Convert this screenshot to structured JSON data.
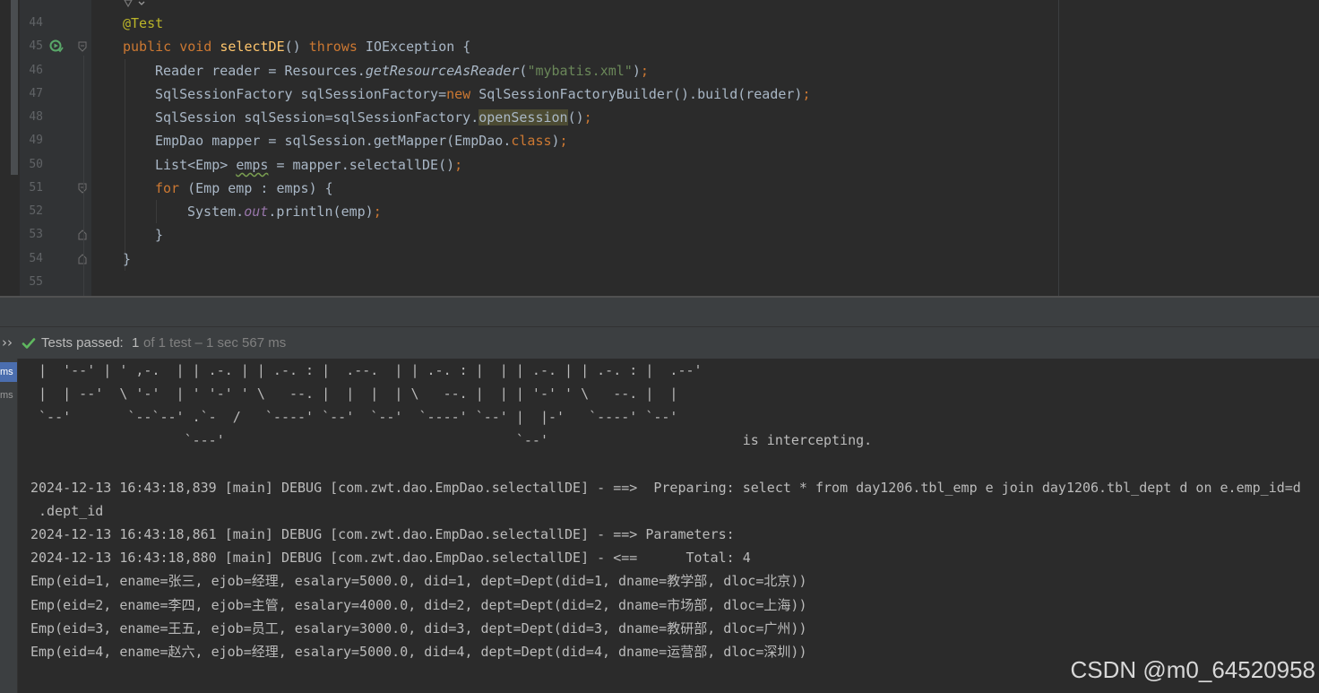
{
  "editor": {
    "line_numbers": [
      "44",
      "45",
      "46",
      "47",
      "48",
      "49",
      "50",
      "51",
      "52",
      "53",
      "54",
      "55"
    ],
    "code": {
      "l44": {
        "annotation": "@Test"
      },
      "l45": {
        "kw1": "public",
        "kw2": "void",
        "method": "selectDE",
        "paren": "() ",
        "kw3": "throws",
        "rest": " IOException {"
      },
      "l46": {
        "a": "Reader reader = Resources.",
        "b": "getResourceAsReader",
        "c": "(",
        "d": "\"mybatis.xml\"",
        "e": ")",
        "f": ";"
      },
      "l47": {
        "a": "SqlSessionFactory sqlSessionFactory=",
        "b": "new",
        "c": " SqlSessionFactoryBuilder().build(reader)",
        "d": ";"
      },
      "l48": {
        "a": "SqlSession sqlSession=sqlSessionFactory.",
        "b": "openSession",
        "c": "()",
        "d": ";"
      },
      "l49": {
        "a": "EmpDao mapper = sqlSession.getMapper(EmpDao.",
        "b": "class",
        "c": ")",
        "d": ";"
      },
      "l50": {
        "a": "List<Emp> ",
        "b": "emps",
        "c": " = mapper.selectallDE()",
        "d": ";"
      },
      "l51": {
        "a": "for",
        "b": " (Emp emp : emps) {"
      },
      "l52": {
        "a": "System.",
        "b": "out",
        "c": ".println(emp)",
        "d": ";"
      },
      "l53": {
        "a": "}"
      },
      "l54": {
        "a": "}"
      }
    }
  },
  "test_bar": {
    "chevron": "››",
    "label": "Tests passed:",
    "count": "1",
    "detail": "of 1 test – 1 sec 567 ms"
  },
  "side_tree": [
    "ms",
    "ms"
  ],
  "console": {
    "lines": [
      " |  '--' | ' ,-.  | | .-. | | .-. : |  .--.  | | .-. : |  | | .-. | | .-. : |  .--'",
      " |  | --'  \\ '-'  | ' '-' ' \\   --. |  |  |  | \\   --. |  | | '-' ' \\   --. |  |",
      " `--'       `--`--' .`-  /   `----' `--'  `--'  `----' `--' |  |-'   `----' `--'",
      "                   `---'                                    `--'                        is intercepting.",
      "",
      "2024-12-13 16:43:18,839 [main] DEBUG [com.zwt.dao.EmpDao.selectallDE] - ==>  Preparing: select * from day1206.tbl_emp e join day1206.tbl_dept d on e.emp_id=d",
      " .dept_id",
      "2024-12-13 16:43:18,861 [main] DEBUG [com.zwt.dao.EmpDao.selectallDE] - ==> Parameters: ",
      "2024-12-13 16:43:18,880 [main] DEBUG [com.zwt.dao.EmpDao.selectallDE] - <==      Total: 4",
      "Emp(eid=1, ename=张三, ejob=经理, esalary=5000.0, did=1, dept=Dept(did=1, dname=教学部, dloc=北京))",
      "Emp(eid=2, ename=李四, ejob=主管, esalary=4000.0, did=2, dept=Dept(did=2, dname=市场部, dloc=上海))",
      "Emp(eid=3, ename=王五, ejob=员工, esalary=3000.0, did=3, dept=Dept(did=3, dname=教研部, dloc=广州))",
      "Emp(eid=4, ename=赵六, ejob=经理, esalary=5000.0, did=4, dept=Dept(did=4, dname=运营部, dloc=深圳))"
    ]
  },
  "watermark": "CSDN @m0_64520958",
  "colors": {
    "background": "#2b2b2b",
    "keyword": "#cc7832",
    "annotation": "#bbb529",
    "method": "#ffc66d",
    "string": "#6a8759",
    "field": "#9876aa",
    "pass_green": "#5fb85f",
    "selection": "#4b6eaf"
  }
}
